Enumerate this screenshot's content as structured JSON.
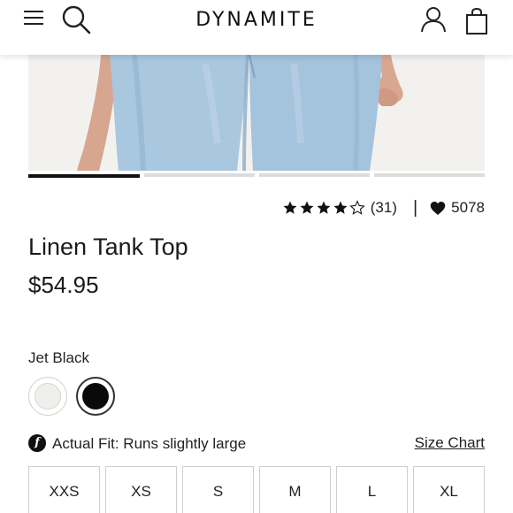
{
  "header": {
    "brand": "DYNAMITE",
    "icons": [
      "menu-icon",
      "search-icon",
      "account-icon",
      "bag-icon"
    ]
  },
  "gallery": {
    "image_count": 4,
    "active_index": 0
  },
  "rating": {
    "stars": 4,
    "max_stars": 5,
    "count_label": "(31)",
    "separator": "|",
    "likes": "5078"
  },
  "product": {
    "title": "Linen Tank Top",
    "price": "$54.95"
  },
  "color": {
    "selected_label": "Jet Black",
    "swatches": [
      {
        "name": "light",
        "color": "#efefec",
        "selected": false
      },
      {
        "name": "black",
        "color": "#0a0a0a",
        "selected": true
      }
    ]
  },
  "fit": {
    "icon_letter": "f",
    "text": "Actual Fit: Runs slightly large",
    "size_chart_label": "Size Chart"
  },
  "sizes": [
    "XXS",
    "XS",
    "S",
    "M",
    "L",
    "XL"
  ]
}
